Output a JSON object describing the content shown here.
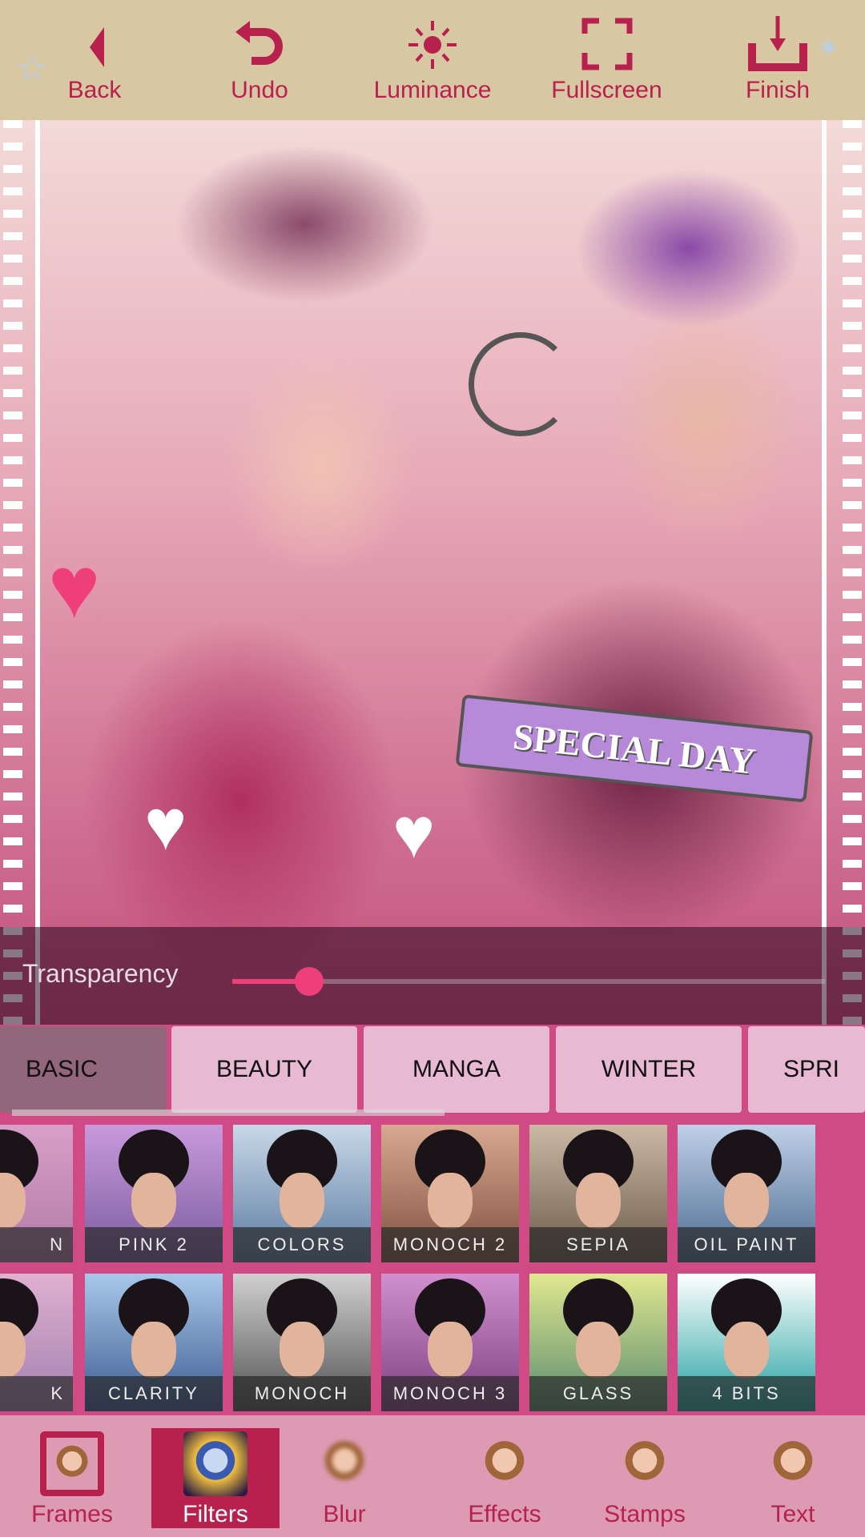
{
  "toolbar": {
    "back": "Back",
    "undo": "Undo",
    "luminance": "Luminance",
    "fullscreen": "Fullscreen",
    "finish": "Finish"
  },
  "photo": {
    "sticker_text": "SPECIAL DAY"
  },
  "transparency": {
    "label": "Transparency",
    "value_percent": 13
  },
  "categories": [
    "BASIC",
    "BEAUTY",
    "MANGA",
    "WINTER",
    "SPRI"
  ],
  "active_category": "BASIC",
  "filters_row1": [
    "N",
    "PINK 2",
    "COLORS",
    "MONOCH 2",
    "SEPIA",
    "OIL PAINT"
  ],
  "filters_row2": [
    "K",
    "CLARITY",
    "MONOCH",
    "MONOCH 3",
    "GLASS",
    "4 BITS"
  ],
  "bottom_nav": [
    "Frames",
    "Filters",
    "Blur",
    "Effects",
    "Stamps",
    "Text"
  ],
  "active_nav": "Filters",
  "colors": {
    "accent": "#b8204e",
    "slider": "#ee3f7a",
    "topbar": "#d8c7a3",
    "bottombar": "#dc9bb3"
  }
}
